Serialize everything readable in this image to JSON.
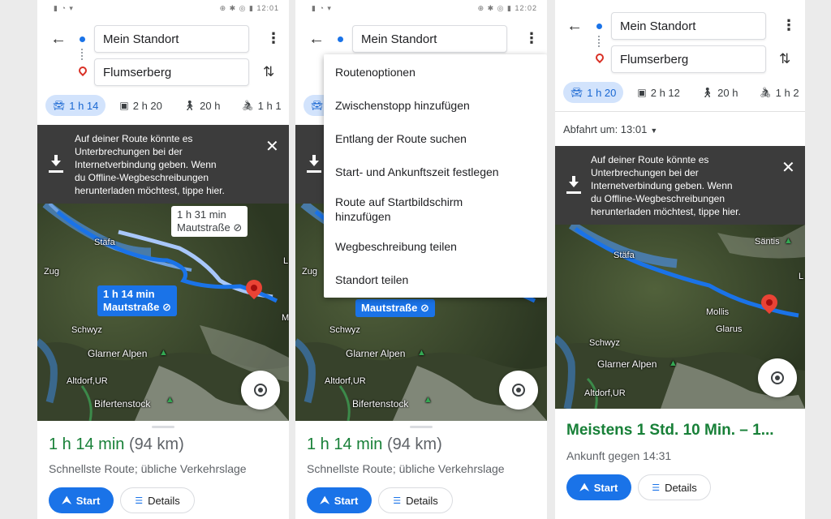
{
  "route": {
    "origin": "Mein Standort",
    "destination": "Flumserberg"
  },
  "phone1": {
    "status_time": "12:01",
    "modes": [
      {
        "icon": "car-icon",
        "label": "1 h 14"
      },
      {
        "icon": "train-icon",
        "label": "2 h 20"
      },
      {
        "icon": "walk-icon",
        "label": "20 h"
      },
      {
        "icon": "bike-icon",
        "label": "1 h 1"
      }
    ],
    "banner_text": [
      "Auf deiner Route könnte es",
      "Unterbrechungen bei der",
      "Internetverbindung geben. Wenn",
      "du Offline-Wegbeschreibungen",
      "herunterladen möchtest, tippe hier."
    ],
    "callout_alt": [
      "1 h 31 min",
      "Mautstraße"
    ],
    "callout_main": [
      "1 h 14 min",
      "Mautstraße"
    ],
    "map_labels": {
      "stafa": "Stäfa",
      "zug": "Zug",
      "schwyz": "Schwyz",
      "glarner": "Glarner Alpen",
      "altdorf": "Altdorf,UR",
      "bifertenstock": "Bifertenstock",
      "l": "L",
      "m": "M"
    },
    "duration": "1 h 14 min",
    "distance": "(94 km)",
    "subtitle": "Schnellste Route; übliche Verkehrslage",
    "start_label": "Start",
    "details_label": "Details"
  },
  "phone2": {
    "status_time": "12:02",
    "menu_items": [
      "Routenoptionen",
      "Zwischenstopp hinzufügen",
      "Entlang der Route suchen",
      "Start- und Ankunftszeit festlegen",
      "Route auf Startbildschirm",
      "hinzufügen",
      "Wegbeschreibung teilen",
      "Standort teilen"
    ],
    "mode_fragment": "1",
    "callout_main": "Mautstraße",
    "map_labels": {
      "zug": "Zug",
      "schwyz": "Schwyz",
      "glarner": "Glarner Alpen",
      "altdorf": "Altdorf,UR",
      "bifertenstock": "Bifertenstock"
    },
    "duration": "1 h 14 min",
    "distance": "(94 km)",
    "subtitle": "Schnellste Route; übliche Verkehrslage",
    "start_label": "Start",
    "details_label": "Details"
  },
  "phone3": {
    "modes": [
      {
        "icon": "car-icon",
        "label": "1 h 20"
      },
      {
        "icon": "train-icon",
        "label": "2 h 12"
      },
      {
        "icon": "walk-icon",
        "label": "20 h"
      },
      {
        "icon": "bike-icon",
        "label": "1 h 2"
      }
    ],
    "departure": "Abfahrt um: 13:01",
    "banner_text": [
      "Auf deiner Route könnte es",
      "Unterbrechungen bei der",
      "Internetverbindung geben. Wenn",
      "du Offline-Wegbeschreibungen",
      "herunterladen möchtest, tippe hier."
    ],
    "map_labels": {
      "santis": "Säntis",
      "stafa": "Stäfa",
      "mollis": "Mollis",
      "glarus": "Glarus",
      "schwyz": "Schwyz",
      "glarner": "Glarner Alpen",
      "altdorf": "Altdorf,UR",
      "l": "L"
    },
    "duration": "Meistens 1 Std. 10 Min. – 1...",
    "arrival": "Ankunft gegen 14:31",
    "start_label": "Start",
    "details_label": "Details"
  },
  "colors": {
    "primary_blue": "#1a73e8",
    "duration_green": "#188038",
    "banner_dark": "#3c3c3c",
    "route_blue": "#4285f4",
    "chip_active": "#d2e3fc"
  }
}
